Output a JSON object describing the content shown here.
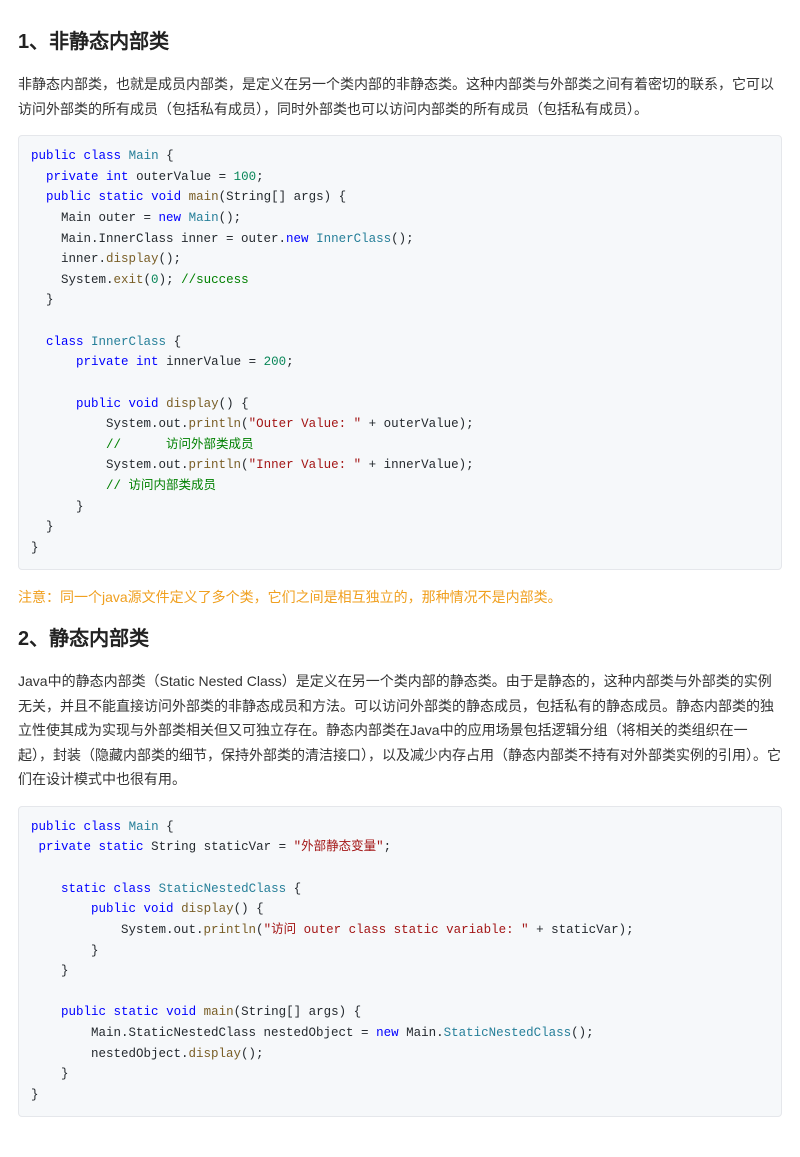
{
  "section1": {
    "heading": "1、非静态内部类",
    "paragraph": "非静态内部类，也就是成员内部类，是定义在另一个类内部的非静态类。这种内部类与外部类之间有着密切的联系，它可以访问外部类的所有成员（包括私有成员），同时外部类也可以访问内部类的所有成员（包括私有成员）。",
    "code1": {
      "t01": "public",
      "t02": "class",
      "t03": "Main",
      "t04": " {",
      "t05": "private",
      "t06": "int",
      "t07": " outerValue = ",
      "n07": "100",
      "t07b": ";",
      "t08": "public",
      "t09": "static",
      "t10": "void",
      "t11": "main",
      "t12": "(String[] args) {",
      "t13": "    Main outer = ",
      "t14": "new",
      "t15": "Main",
      "t16": "();",
      "t17": "    Main.InnerClass inner = outer.",
      "t18": "new",
      "t19": "InnerClass",
      "t20": "();",
      "t21": "    inner.",
      "t22": "display",
      "t23": "();",
      "t24": "    System.",
      "t25": "exit",
      "t26": "(",
      "n26": "0",
      "t26b": "); ",
      "t27": "//success",
      "t28": "  }",
      "t30": "class",
      "t31": "InnerClass",
      "t32": " {",
      "t33": "private",
      "t34": "int",
      "t35": " innerValue = ",
      "n35": "200",
      "t35b": ";",
      "t36": "public",
      "t37": "void",
      "t38": "display",
      "t39": "() {",
      "t40": "          System.out.",
      "t41": "println",
      "t42": "(",
      "t43": "\"Outer Value: \"",
      "t44": " + outerValue);",
      "t45": "          //      访问外部类成员",
      "t46": "          System.out.",
      "t47": "println",
      "t48": "(",
      "t49": "\"Inner Value: \"",
      "t50": " + innerValue);",
      "t51": "          // 访问内部类成员",
      "t52": "      }",
      "t53": "  }",
      "t54": "}"
    },
    "note": "注意：同一个java源文件定义了多个类，它们之间是相互独立的，那种情况不是内部类。"
  },
  "section2": {
    "heading": "2、静态内部类",
    "paragraph": "Java中的静态内部类（Static Nested Class）是定义在另一个类内部的静态类。由于是静态的，这种内部类与外部类的实例无关，并且不能直接访问外部类的非静态成员和方法。可以访问外部类的静态成员，包括私有的静态成员。静态内部类的独立性使其成为实现与外部类相关但又可独立存在。静态内部类在Java中的应用场景包括逻辑分组（将相关的类组织在一起），封装（隐藏内部类的细节，保持外部类的清洁接口），以及减少内存占用（静态内部类不持有对外部类实例的引用）。它们在设计模式中也很有用。",
    "code2": {
      "t01": "public",
      "t02": "class",
      "t03": "Main",
      "t04": " {",
      "t05": "private",
      "t06": "static",
      "t07": " String staticVar = ",
      "t08": "\"外部静态变量\"",
      "t09": ";",
      "t10": "static",
      "t11": "class",
      "t12": "StaticNestedClass",
      "t13": " {",
      "t14": "public",
      "t15": "void",
      "t16": "display",
      "t17": "() {",
      "t18": "            System.out.",
      "t19": "println",
      "t20": "(",
      "t21": "\"访问 outer class static variable: \"",
      "t22": " + staticVar);",
      "t23": "        }",
      "t24": "    }",
      "t25": "public",
      "t26": "static",
      "t27": "void",
      "t28": "main",
      "t29": "(String[] args) {",
      "t30": "        Main.StaticNestedClass nestedObject = ",
      "t31": "new",
      "t32": " Main.",
      "t33": "StaticNestedClass",
      "t34": "();",
      "t35": "        nestedObject.",
      "t36": "display",
      "t37": "();",
      "t38": "    }",
      "t39": "}"
    }
  }
}
